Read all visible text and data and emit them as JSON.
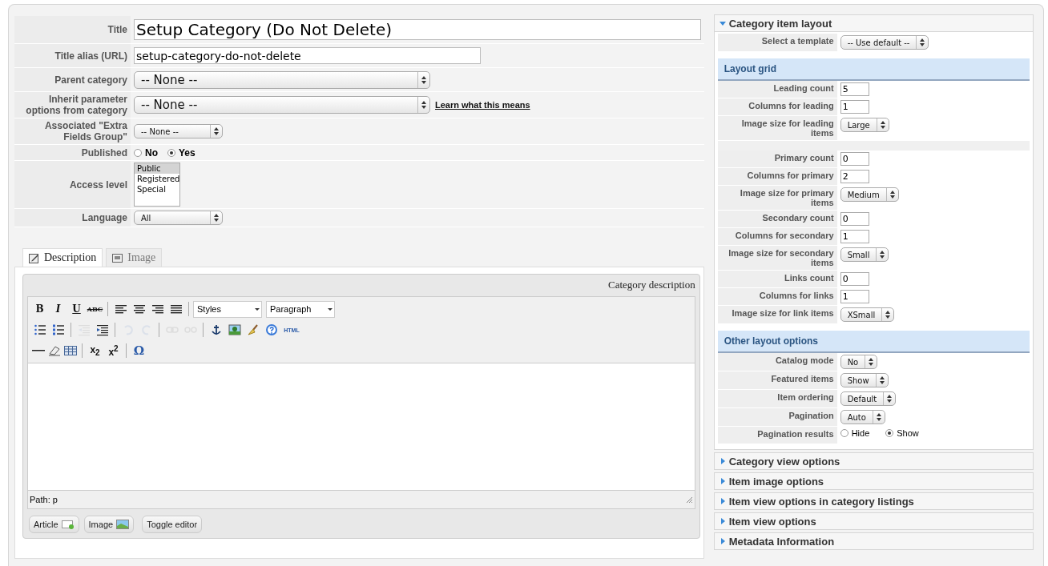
{
  "form": {
    "fields": [
      {
        "kind": "title",
        "label": "Title",
        "value": "Setup Category (Do Not Delete)"
      },
      {
        "kind": "text",
        "label": "Title alias (URL)",
        "value": "setup-category-do-not-delete"
      },
      {
        "kind": "bigselect",
        "label": "Parent category",
        "value": "-- None --"
      },
      {
        "kind": "bigselect",
        "label": "Inherit parameter options from category",
        "value": "-- None --",
        "link": "Learn what this means"
      },
      {
        "kind": "select",
        "label": "Associated \"Extra Fields Group\"",
        "value": "-- None --"
      },
      {
        "kind": "radio",
        "label": "Published",
        "options": [
          {
            "label": "No",
            "selected": false
          },
          {
            "label": "Yes",
            "selected": true
          }
        ]
      },
      {
        "kind": "list",
        "label": "Access level",
        "options": [
          {
            "label": "Public",
            "selected": true
          },
          {
            "label": "Registered",
            "selected": false
          },
          {
            "label": "Special",
            "selected": false
          }
        ]
      },
      {
        "kind": "select",
        "label": "Language",
        "value": "All"
      }
    ]
  },
  "tabs": [
    {
      "label": "Description",
      "selected": true
    },
    {
      "label": "Image",
      "selected": false
    }
  ],
  "editor": {
    "caption": "Category description",
    "format_buttons": [
      "B",
      "I",
      "U",
      "ABC"
    ],
    "style_select": "Styles",
    "block_select": "Paragraph",
    "tools": [
      {
        "disabled": false
      },
      {
        "disabled": false
      },
      {
        "disabled": true
      },
      {
        "disabled": false
      },
      {
        "disabled": true
      },
      {
        "disabled": true
      },
      {
        "disabled": true
      },
      {
        "disabled": true
      },
      {
        "disabled": false
      },
      {
        "disabled": false
      },
      {
        "disabled": false
      },
      {
        "disabled": false
      }
    ],
    "html_button": "HTML",
    "sub_button": "x$_{2}$",
    "sup_button": "x$^{2}$",
    "char_button": "Ω",
    "path": "Path: p",
    "buttons": [
      "Article",
      "Image",
      "Toggle editor"
    ]
  },
  "sidebar": {
    "panels": [
      {
        "title": "Category item layout",
        "expanded": true,
        "sections": [
          {
            "rows": [
              {
                "kind": "select",
                "label": "Select a template",
                "value": "-- Use default --"
              }
            ]
          },
          {
            "heading": "Layout grid",
            "rows": [
              {
                "kind": "input",
                "label": "Leading count",
                "value": "5"
              },
              {
                "kind": "input",
                "label": "Columns for leading",
                "value": "1"
              },
              {
                "kind": "select",
                "label": "Image size for leading items",
                "value": "Large"
              },
              {
                "kind": "gap"
              },
              {
                "kind": "input",
                "label": "Primary count",
                "value": "0"
              },
              {
                "kind": "input",
                "label": "Columns for primary",
                "value": "2"
              },
              {
                "kind": "select",
                "label": "Image size for primary items",
                "value": "Medium"
              },
              {
                "kind": "input",
                "label": "Secondary count",
                "value": "0"
              },
              {
                "kind": "input",
                "label": "Columns for secondary",
                "value": "1"
              },
              {
                "kind": "select",
                "label": "Image size for secondary items",
                "value": "Small"
              },
              {
                "kind": "input",
                "label": "Links count",
                "value": "0"
              },
              {
                "kind": "input",
                "label": "Columns for links",
                "value": "1"
              },
              {
                "kind": "select",
                "label": "Image size for link items",
                "value": "XSmall"
              }
            ]
          },
          {
            "heading": "Other layout options",
            "rows": [
              {
                "kind": "select",
                "label": "Catalog mode",
                "value": "No"
              },
              {
                "kind": "select",
                "label": "Featured items",
                "value": "Show"
              },
              {
                "kind": "select",
                "label": "Item ordering",
                "value": "Default"
              },
              {
                "kind": "select",
                "label": "Pagination",
                "value": "Auto"
              },
              {
                "kind": "radio",
                "label": "Pagination results",
                "options": [
                  {
                    "label": "Hide",
                    "selected": false
                  },
                  {
                    "label": "Show",
                    "selected": true
                  }
                ]
              }
            ]
          }
        ]
      },
      {
        "title": "Category view options",
        "expanded": false
      },
      {
        "title": "Item image options",
        "expanded": false
      },
      {
        "title": "Item view options in category listings",
        "expanded": false
      },
      {
        "title": "Item view options",
        "expanded": false
      },
      {
        "title": "Metadata Information",
        "expanded": false
      }
    ]
  }
}
